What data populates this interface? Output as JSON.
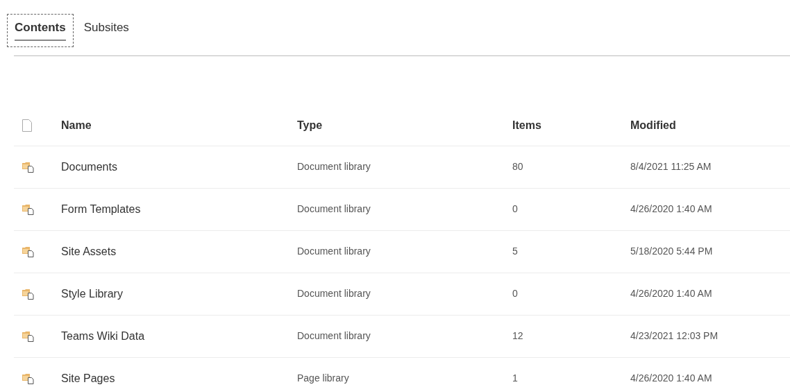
{
  "tabs": [
    {
      "label": "Contents",
      "selected": true
    },
    {
      "label": "Subsites",
      "selected": false
    }
  ],
  "table": {
    "columns": [
      "Name",
      "Type",
      "Items",
      "Modified"
    ],
    "rows": [
      {
        "name": "Documents",
        "type": "Document library",
        "items": "80",
        "modified": "8/4/2021 11:25 AM"
      },
      {
        "name": "Form Templates",
        "type": "Document library",
        "items": "0",
        "modified": "4/26/2020 1:40 AM"
      },
      {
        "name": "Site Assets",
        "type": "Document library",
        "items": "5",
        "modified": "5/18/2020 5:44 PM"
      },
      {
        "name": "Style Library",
        "type": "Document library",
        "items": "0",
        "modified": "4/26/2020 1:40 AM"
      },
      {
        "name": "Teams Wiki Data",
        "type": "Document library",
        "items": "12",
        "modified": "4/23/2021 12:03 PM"
      },
      {
        "name": "Site Pages",
        "type": "Page library",
        "items": "1",
        "modified": "4/26/2020 1:40 AM"
      }
    ]
  }
}
